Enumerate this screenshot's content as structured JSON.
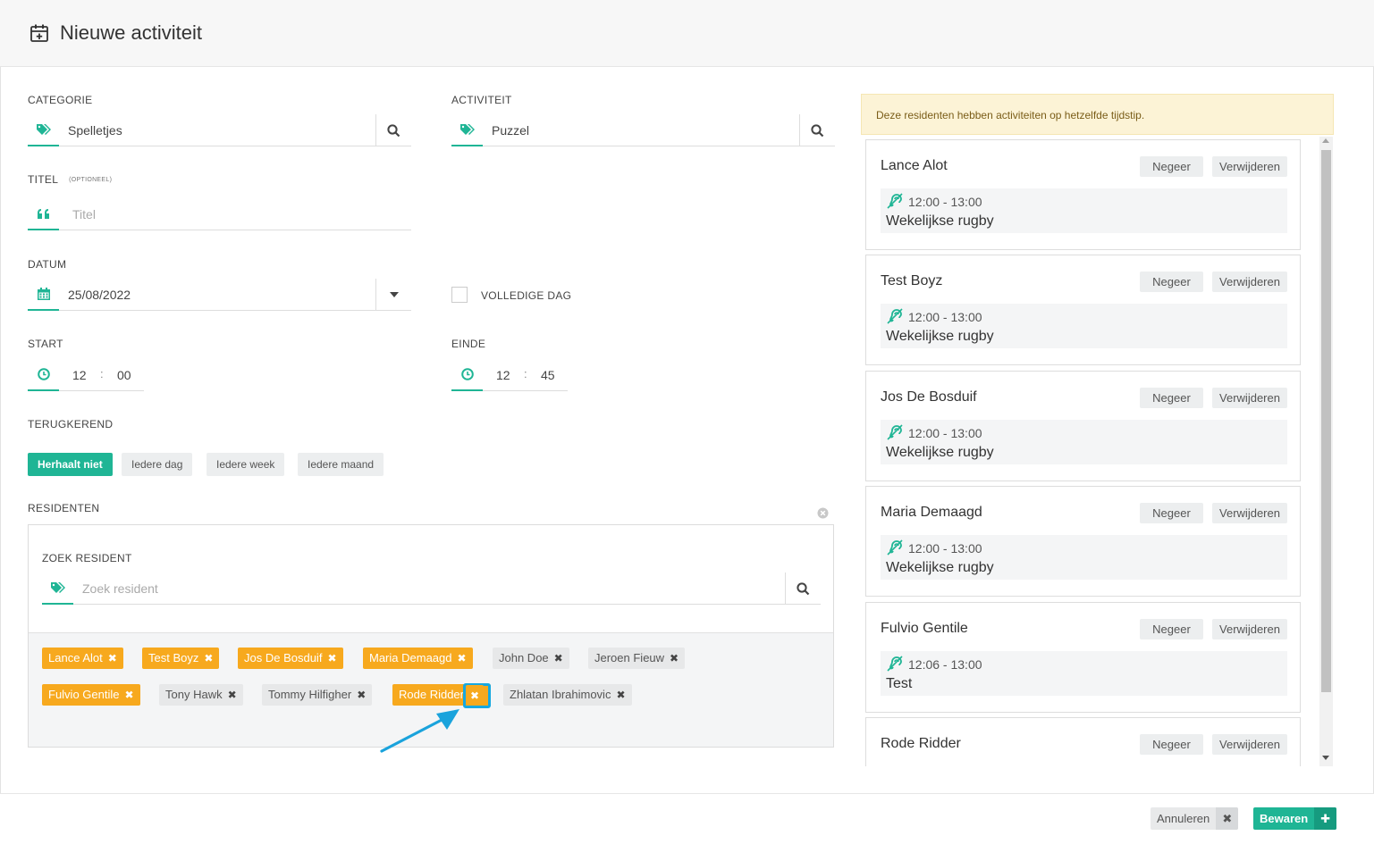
{
  "dialog": {
    "title": "Nieuwe activiteit"
  },
  "form": {
    "category": {
      "label": "CATEGORIE",
      "value": "Spelletjes"
    },
    "activity": {
      "label": "ACTIVITEIT",
      "value": "Puzzel"
    },
    "titel": {
      "label": "TITEL",
      "optional": "(OPTIONEEL)",
      "placeholder": "Titel"
    },
    "datum": {
      "label": "DATUM",
      "value": "25/08/2022"
    },
    "full_day": {
      "label": "VOLLEDIGE DAG",
      "checked": false
    },
    "start": {
      "label": "START",
      "hour": "12",
      "minute": "00"
    },
    "einde": {
      "label": "EINDE",
      "hour": "12",
      "minute": "45"
    },
    "recurring": {
      "label": "TERUGKEREND",
      "options": [
        "Herhaalt niet",
        "Iedere dag",
        "Iedere week",
        "Iedere maand"
      ],
      "selected": "Herhaalt niet"
    },
    "residents": {
      "label": "RESIDENTEN",
      "search_label": "ZOEK RESIDENT",
      "search_placeholder": "Zoek resident",
      "tags": [
        {
          "name": "Lance Alot",
          "selected": true
        },
        {
          "name": "Test Boyz",
          "selected": true
        },
        {
          "name": "Jos De Bosduif",
          "selected": true
        },
        {
          "name": "Maria Demaagd",
          "selected": true
        },
        {
          "name": "John Doe",
          "selected": false
        },
        {
          "name": "Jeroen Fieuw",
          "selected": false
        },
        {
          "name": "Fulvio Gentile",
          "selected": true
        },
        {
          "name": "Tony Hawk",
          "selected": false
        },
        {
          "name": "Tommy Hilfigher",
          "selected": false
        },
        {
          "name": "Rode Ridder",
          "selected": true
        },
        {
          "name": "Zhlatan Ibrahimovic",
          "selected": false
        }
      ]
    }
  },
  "conflicts": {
    "warning": "Deze residenten hebben activiteiten op hetzelfde tijdstip.",
    "ignore_label": "Negeer",
    "remove_label": "Verwijderen",
    "items": [
      {
        "name": "Lance Alot",
        "time": "12:00 - 13:00",
        "activity": "Wekelijkse rugby"
      },
      {
        "name": "Test Boyz",
        "time": "12:00 - 13:00",
        "activity": "Wekelijkse rugby"
      },
      {
        "name": "Jos De Bosduif",
        "time": "12:00 - 13:00",
        "activity": "Wekelijkse rugby"
      },
      {
        "name": "Maria Demaagd",
        "time": "12:00 - 13:00",
        "activity": "Wekelijkse rugby"
      },
      {
        "name": "Fulvio Gentile",
        "time": "12:06 - 13:00",
        "activity": "Test"
      },
      {
        "name": "Rode Ridder",
        "time": "",
        "activity": ""
      }
    ]
  },
  "footer": {
    "cancel_label": "Annuleren",
    "save_label": "Bewaren"
  },
  "colors": {
    "accent": "#1fb595",
    "selected_tag": "#f7a91e",
    "warning_bg": "#fcf3d6",
    "highlight": "#16a8e0"
  }
}
